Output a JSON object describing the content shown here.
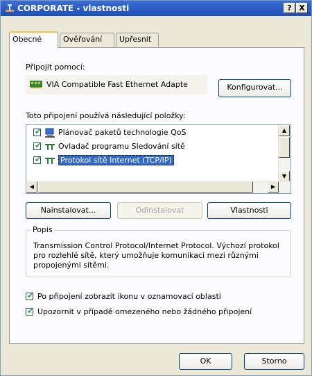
{
  "window": {
    "title": "CORPORATE - vlastnosti",
    "help_button": "?",
    "close_button": "X"
  },
  "tabs": [
    {
      "label": "Obecné",
      "active": true
    },
    {
      "label": "Ověřování",
      "active": false
    },
    {
      "label": "Upřesnit",
      "active": false
    }
  ],
  "connect_using": {
    "label": "Připojit pomocí:",
    "adapter_name": "VIA Compatible Fast Ethernet Adapte",
    "configure_button": "Konfigurovat..."
  },
  "items_section": {
    "label": "Toto připojení používá následující položky:",
    "items": [
      {
        "label": "Plánovač paketů technologie QoS",
        "checked": true,
        "icon": "qos-scheduler-icon",
        "selected": false
      },
      {
        "label": "Ovladač programu Sledování sítě",
        "checked": true,
        "icon": "network-monitor-icon",
        "selected": false
      },
      {
        "label": "Protokol sítě Internet (TCP/IP)",
        "checked": true,
        "icon": "protocol-icon",
        "selected": true
      }
    ]
  },
  "item_buttons": {
    "install": "Nainstalovat...",
    "uninstall": "Odinstalovat",
    "properties": "Vlastnosti"
  },
  "description": {
    "title": "Popis",
    "text": "Transmission Control Protocol/Internet Protocol. Výchozí protokol pro rozlehlé sítě, který umožňuje komunikaci mezi různými propojenými sítěmi."
  },
  "options": [
    {
      "label": "Po připojení zobrazit ikonu v oznamovací oblasti",
      "checked": true
    },
    {
      "label": "Upozornit v případě omezeného nebo žádného připojení",
      "checked": true
    }
  ],
  "footer": {
    "ok": "OK",
    "cancel": "Storno"
  }
}
